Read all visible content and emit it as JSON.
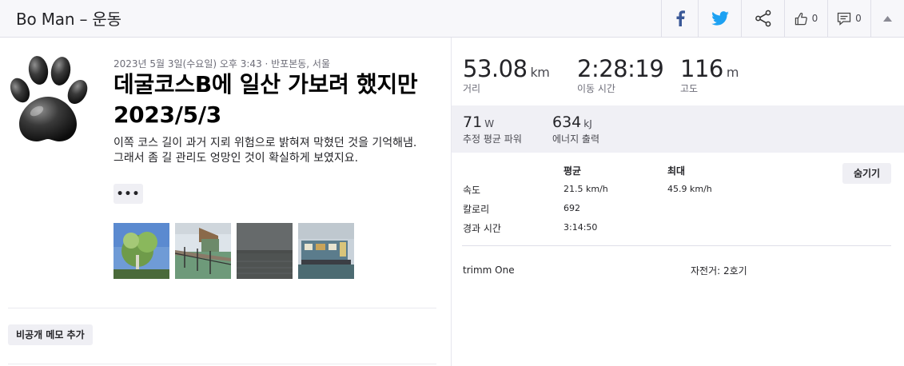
{
  "header": {
    "title": "Bo Man – 운동",
    "kudos_count": "0",
    "comment_count": "0"
  },
  "activity": {
    "meta": "2023년 5월 3일(수요일) 오후 3:43 · 반포본동, 서울",
    "title": "데굴코스B에 일산 가보려 했지만 2023/5/3",
    "description_line1": "이쪽 코스 길이 과거 지뢰 위험으로 밝혀져 막혔던 것을 기억해냄.",
    "description_line2": "그래서 좀 길 관리도 엉망인 것이 확실하게 보였지요.",
    "more_label": "•••",
    "memo_label": "비공개 메모 추가"
  },
  "photos": [
    {
      "subject": "tree"
    },
    {
      "subject": "boardwalk"
    },
    {
      "subject": "river"
    },
    {
      "subject": "boat"
    }
  ],
  "stats": {
    "distance": {
      "value": "53.08",
      "unit": "km",
      "label": "거리"
    },
    "moving_time": {
      "value": "2:28:19",
      "label": "이동 시간"
    },
    "elevation": {
      "value": "116",
      "unit": "m",
      "label": "고도"
    }
  },
  "secondary": {
    "power": {
      "value": "71",
      "unit": "W",
      "label": "추정 평균 파워"
    },
    "energy": {
      "value": "634",
      "unit": "kJ",
      "label": "에너지 출력"
    }
  },
  "table": {
    "col_avg": "평균",
    "col_max": "최대",
    "hide_label": "숨기기",
    "rows": [
      {
        "label": "속도",
        "avg": "21.5 km/h",
        "max": "45.9 km/h"
      },
      {
        "label": "칼로리",
        "avg": "692",
        "max": ""
      },
      {
        "label": "경과 시간",
        "avg": "3:14:50",
        "max": ""
      }
    ]
  },
  "device": "trimm One",
  "bike": "자전거: 2호기",
  "colors": {
    "facebook": "#3b5998",
    "twitter": "#1da1f2",
    "header_bg": "#f7f7fa",
    "panel_bg": "#f0f0f5"
  }
}
